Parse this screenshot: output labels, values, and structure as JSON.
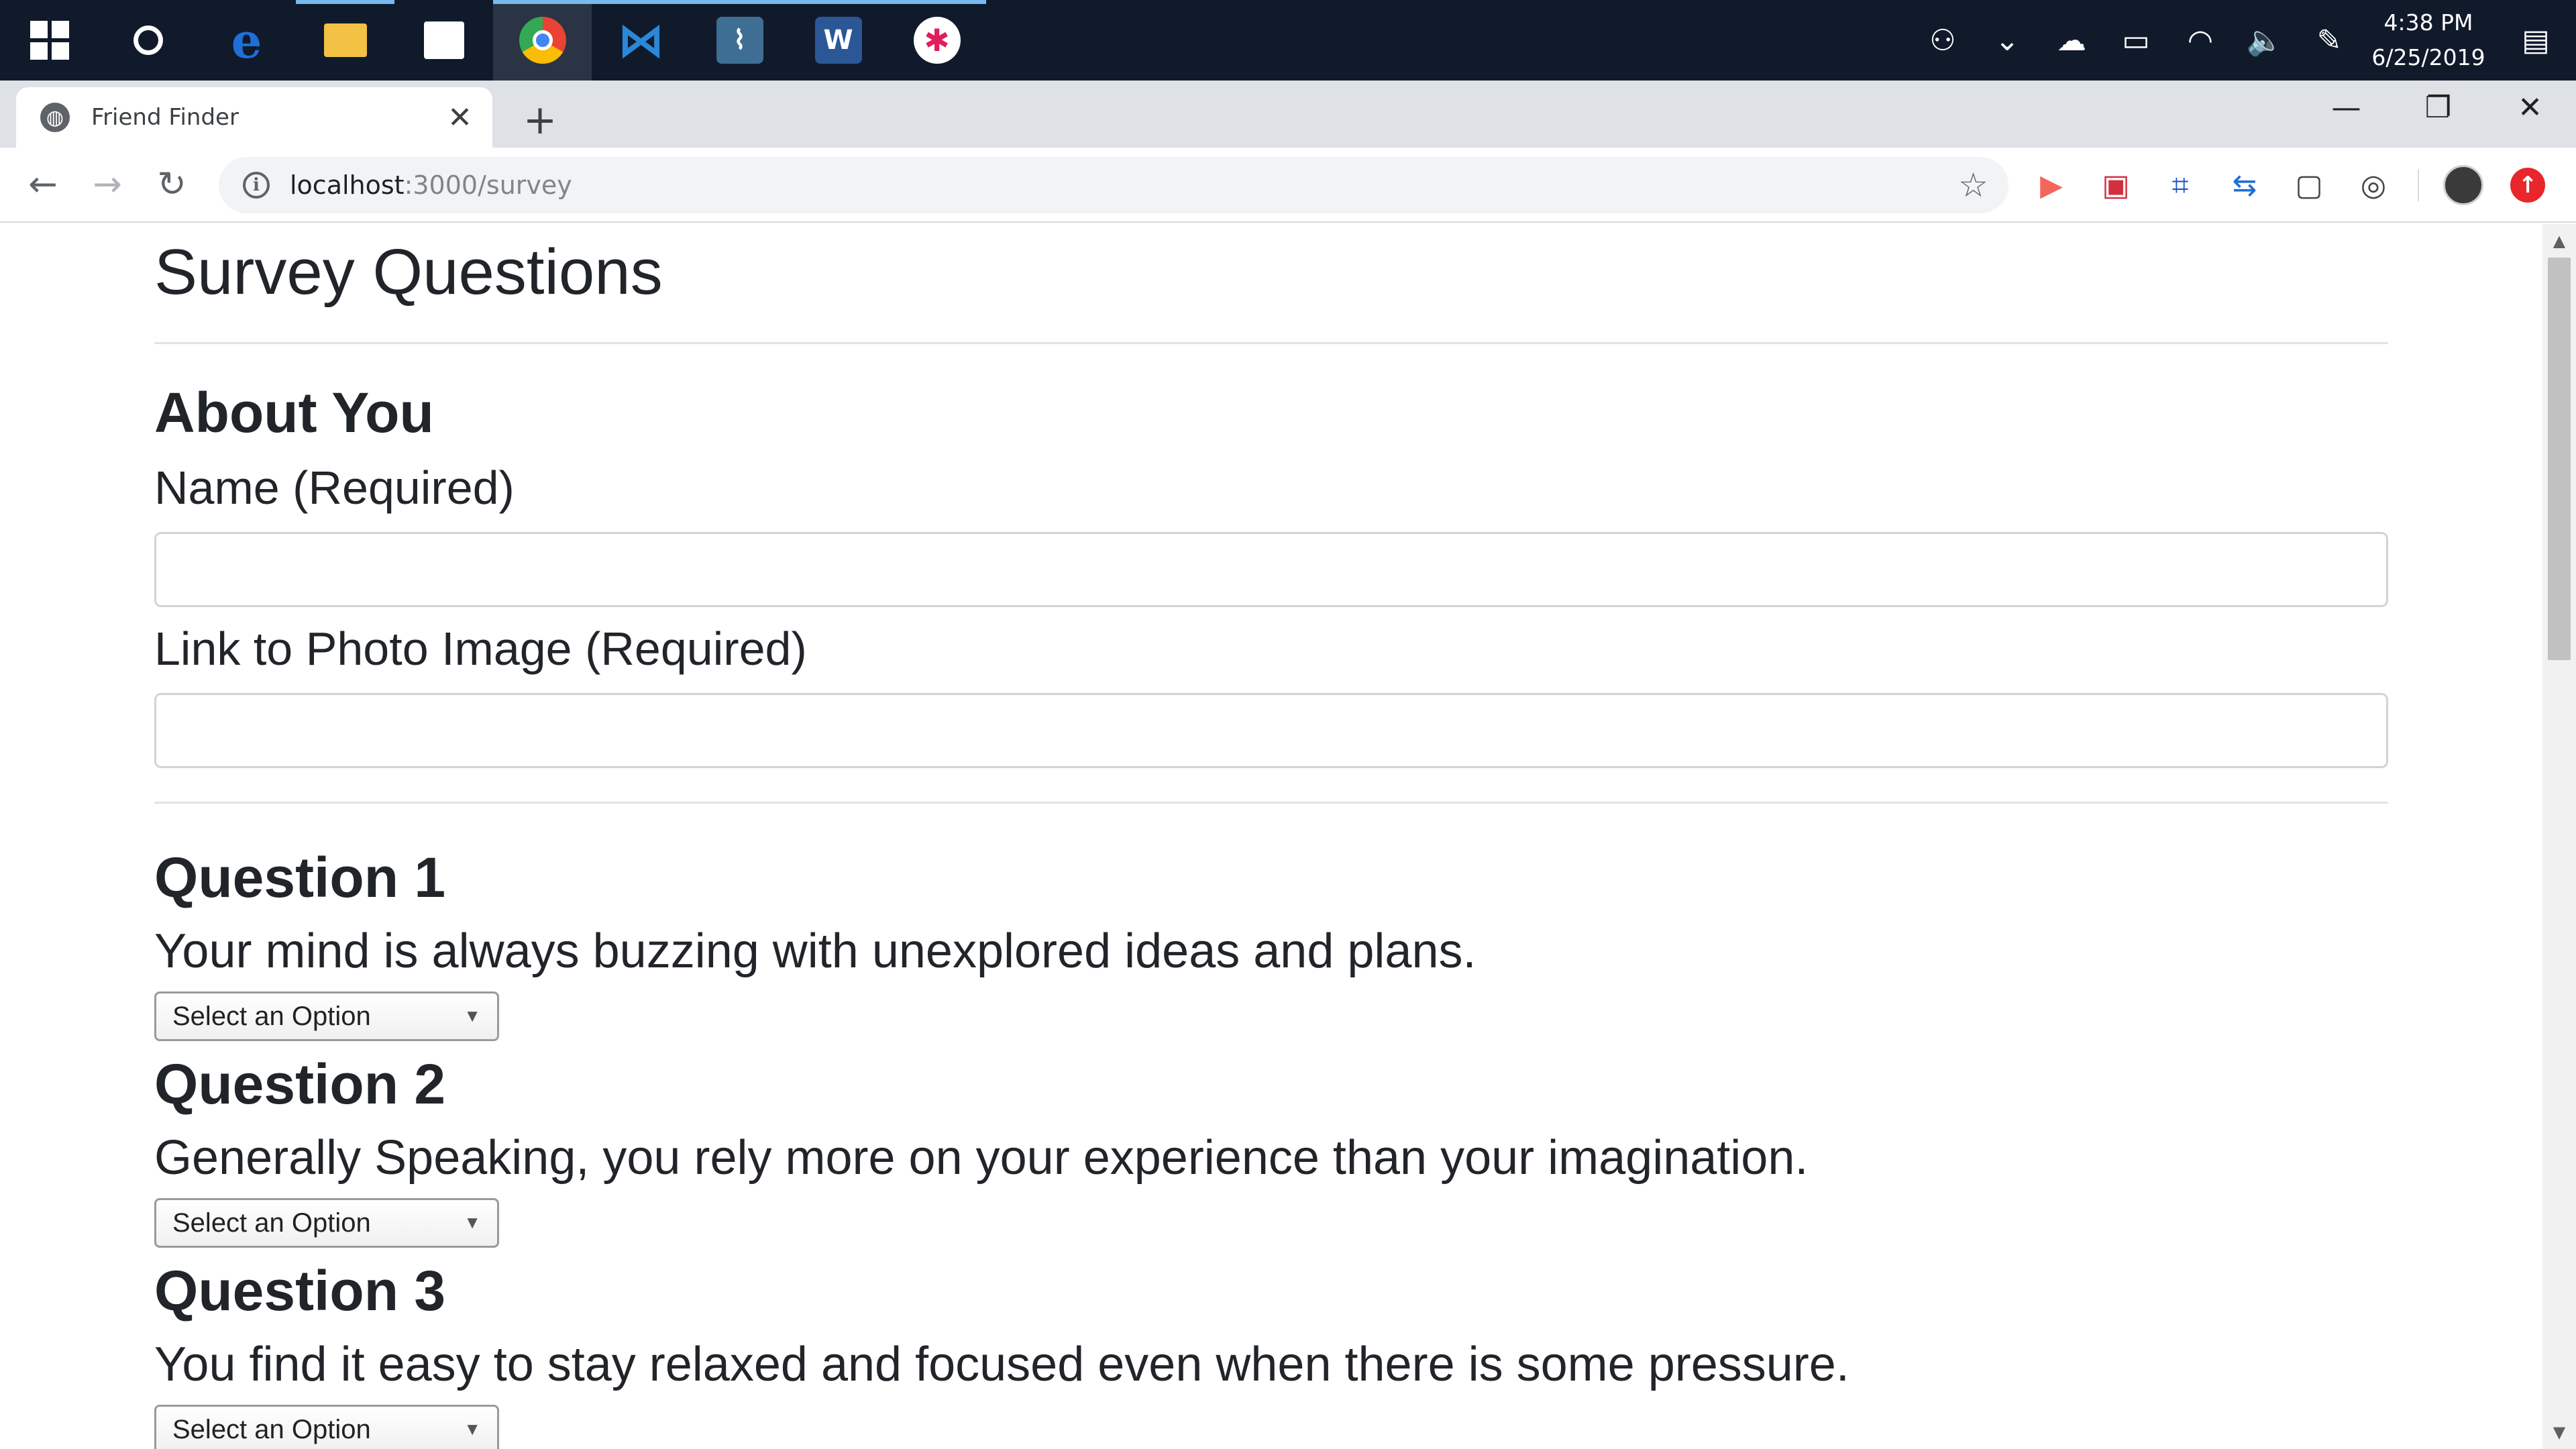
{
  "taskbar": {
    "apps": [
      {
        "name": "edge",
        "glyph": "e",
        "color": "#1f6fd6"
      },
      {
        "name": "file-explorer",
        "glyph": "📁",
        "color": "#f3c244"
      },
      {
        "name": "store",
        "glyph": "🛍",
        "color": "#ffffff"
      },
      {
        "name": "chrome",
        "glyph": "◉",
        "color": "#e8453c"
      },
      {
        "name": "vscode",
        "glyph": "⋈",
        "color": "#2b88d8"
      },
      {
        "name": "mysql-workbench",
        "glyph": "⌇",
        "color": "#3e6e93"
      },
      {
        "name": "word",
        "glyph": "W",
        "color": "#2b5797"
      },
      {
        "name": "slack",
        "glyph": "✱",
        "color": "#ffffff"
      }
    ],
    "clock_time": "4:38 PM",
    "clock_date": "6/25/2019"
  },
  "browser": {
    "tab_title": "Friend Finder",
    "url_host": "localhost",
    "url_path": ":3000/survey"
  },
  "page": {
    "title": "Survey Questions",
    "about_heading": "About You",
    "name_label": "Name (Required)",
    "photo_label": "Link to Photo Image (Required)",
    "questions": [
      {
        "title": "Question 1",
        "text": "Your mind is always buzzing with unexplored ideas and plans.",
        "selected": "Select an Option"
      },
      {
        "title": "Question 2",
        "text": "Generally Speaking, you rely more on your experience than your imagination.",
        "selected": "Select an Option"
      },
      {
        "title": "Question 3",
        "text": "You find it easy to stay relaxed and focused even when there is some pressure.",
        "selected": "Select an Option"
      }
    ]
  },
  "colors": {
    "taskbar_bg": "#101a2b",
    "tabstrip_bg": "#dee1e6",
    "text": "#212529"
  }
}
